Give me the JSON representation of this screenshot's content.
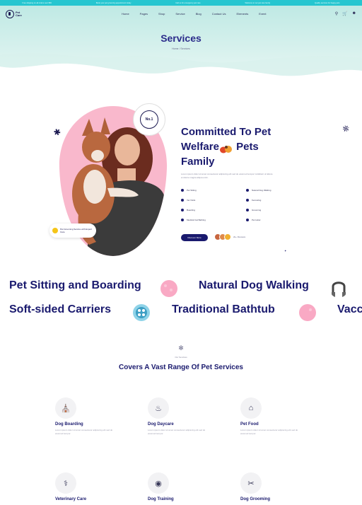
{
  "topbar": {
    "messages": [
      "Free shipping on all orders over $50",
      "Book your pet grooming appointment today",
      "Call us for emergency pet care",
      "Welcome to our pet care family",
      "Quality services for happy pets"
    ]
  },
  "nav": {
    "logo": "Pet Care",
    "menu": [
      "Home",
      "Pages",
      "Shop",
      "Service",
      "Blog",
      "Contact Us",
      "Elements",
      "Event"
    ],
    "icons": [
      "search-icon",
      "cart-icon",
      "user-icon"
    ]
  },
  "hero": {
    "title": "Services",
    "breadcrumb": "Home / Services"
  },
  "about": {
    "badge": "No.1",
    "pill_text": "Pet Grooming Service with Expert Care",
    "title_line1": "Committed To Pet",
    "title_line2_a": "Welfare",
    "title_line2_b": "Pets",
    "title_line3": "Family",
    "description": "Lorem ipsum dolor sit amet consectetur adipiscing elit sed do eiusmod tempor incididunt ut labore et dolore magna aliqua enim.",
    "features": [
      "Pet Sitting",
      "Natural Dog Walking",
      "Vet Visits",
      "Kenneling",
      "Boarding",
      "Grooming",
      "Medical Cat Bathing",
      "Pet Hotel"
    ],
    "cta_label": "Discover More",
    "reviews_text": "2k+ Reviews"
  },
  "marquee": {
    "row1": [
      "Pet Sitting and Boarding",
      "Natural Dog Walking"
    ],
    "row2": [
      "Soft-sided Carriers",
      "Traditional Bathtub",
      "Vacc"
    ]
  },
  "services": {
    "kicker": "Our Services",
    "title": "Covers A Vast Range Of Pet Services",
    "cards": [
      {
        "title": "Dog Boarding",
        "desc": "Lorem ipsum dolor sit amet consectetur adipiscing elit sed do eiusmod tempor.",
        "icon": "dog-boarding-icon"
      },
      {
        "title": "Dog Daycare",
        "desc": "Lorem ipsum dolor sit amet consectetur adipiscing elit sed do eiusmod tempor.",
        "icon": "dog-daycare-icon"
      },
      {
        "title": "Pet Food",
        "desc": "Lorem ipsum dolor sit amet consectetur adipiscing elit sed do eiusmod tempor.",
        "icon": "pet-food-icon"
      },
      {
        "title": "Veterinary Care",
        "desc": "",
        "icon": "veterinary-care-icon"
      },
      {
        "title": "Dog Training",
        "desc": "",
        "icon": "dog-training-icon"
      },
      {
        "title": "Dog Grooming",
        "desc": "",
        "icon": "dog-grooming-icon"
      }
    ]
  },
  "colors": {
    "accent": "#1a1a6e",
    "teal": "#26c6d0",
    "pink": "#f9b8cc",
    "hero_bg": "#c8ece8"
  }
}
